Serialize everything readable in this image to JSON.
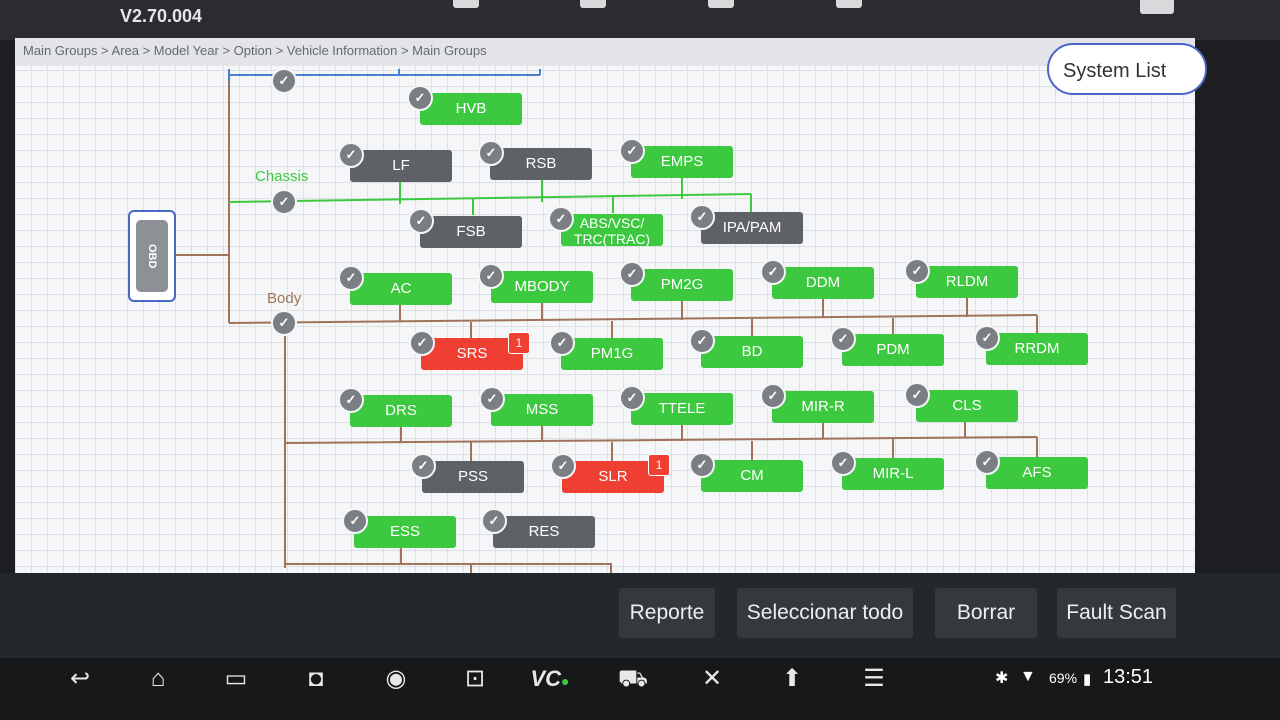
{
  "app": {
    "version": "V2.70.004"
  },
  "breadcrumb": "Main Groups > Area > Model Year > Option > Vehicle Information > Main Groups",
  "system_list_label": "System List",
  "obd_label": "OBD",
  "groups": {
    "chassis": "Chassis",
    "body": "Body"
  },
  "colors": {
    "ok": "#3dc93f",
    "inactive": "#5e6166",
    "fault": "#ee3f32",
    "chassis": "#3dc93f",
    "body": "#a0735a"
  },
  "modules": {
    "hvb": "HVB",
    "lf": "LF",
    "rsb": "RSB",
    "emps": "EMPS",
    "fsb": "FSB",
    "abs": "ABS/VSC/\nTRC(TRAC)",
    "ipa": "IPA/PAM",
    "ac": "AC",
    "mbody": "MBODY",
    "pm2g": "PM2G",
    "ddm": "DDM",
    "rldm": "RLDM",
    "srs": "SRS",
    "pm1g": "PM1G",
    "bd": "BD",
    "pdm": "PDM",
    "rrdm": "RRDM",
    "drs": "DRS",
    "mss": "MSS",
    "ttele": "TTELE",
    "mirr": "MIR-R",
    "cls": "CLS",
    "pss": "PSS",
    "slr": "SLR",
    "cm": "CM",
    "mirl": "MIR-L",
    "afs": "AFS",
    "ess": "ESS",
    "res": "RES"
  },
  "fault_counts": {
    "srs": "1",
    "slr": "1"
  },
  "actions": {
    "report": "Reporte",
    "select_all": "Seleccionar todo",
    "clear": "Borrar",
    "fault_scan": "Fault Scan"
  },
  "status": {
    "battery": "69%",
    "time": "13:51"
  },
  "nav_icons": [
    "back-icon",
    "home-icon",
    "recent-apps-icon",
    "camera-icon",
    "browser-icon",
    "crop-icon",
    "vci-icon",
    "vehicle-icon",
    "tools-icon",
    "upload-icon",
    "menu-icon"
  ]
}
